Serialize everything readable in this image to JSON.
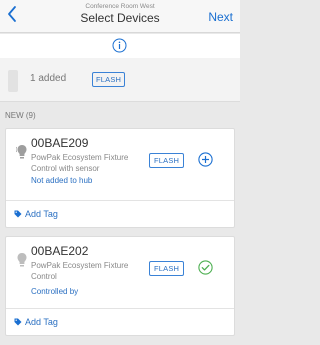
{
  "header": {
    "subtitle": "Conference Room West",
    "title": "Select Devices",
    "next_label": "Next"
  },
  "added": {
    "text": "1 added",
    "badge": "FLASH"
  },
  "section_label": "NEW (9)",
  "devices": [
    {
      "id": "00BAE209",
      "description": "PowPak Ecosystem Fixture Control with sensor",
      "badge": "FLASH",
      "status": "Not added to hub",
      "action_icon": "add-circle-icon",
      "tag_label": "Add Tag"
    },
    {
      "id": "00BAE202",
      "description": "PowPak Ecosystem Fixture Control",
      "badge": "FLASH",
      "status": "Controlled by",
      "action_icon": "check-circle-icon",
      "tag_label": "Add Tag"
    }
  ],
  "colors": {
    "accent": "#1a6fd1",
    "success": "#4caf50",
    "background": "#e9e9e9"
  }
}
